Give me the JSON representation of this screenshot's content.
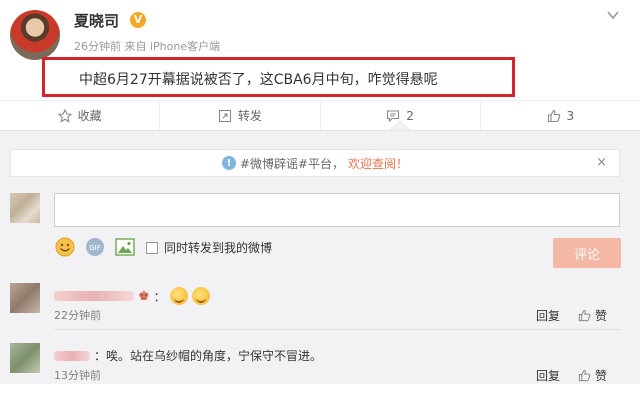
{
  "post": {
    "author": "夏晓司",
    "verified_badge": "V",
    "meta": "26分钟前 来自 iPhone客户端",
    "content": "中超6月27开幕据说被否了，这CBA6月中旬，咋觉得悬呢",
    "highlight_color": "#d4262a"
  },
  "actions": {
    "favorite_label": "收藏",
    "forward_label": "转发",
    "comment_count": "2",
    "like_count": "3"
  },
  "comment_panel": {
    "notice_prefix": "#微博辟谣#平台，",
    "notice_link": "欢迎查阅！",
    "notice_close": "×",
    "input_value": "",
    "sync_label": "同时转发到我的微博",
    "submit_label": "评论",
    "accent_color": "#eb7350"
  },
  "comments": [
    {
      "text": "：",
      "time": "22分钟前",
      "reply_label": "回复",
      "like_label": "赞"
    },
    {
      "text": "：唉。站在乌纱帽的角度，宁保守不冒进。",
      "time": "13分钟前",
      "reply_label": "回复",
      "like_label": "赞"
    }
  ]
}
